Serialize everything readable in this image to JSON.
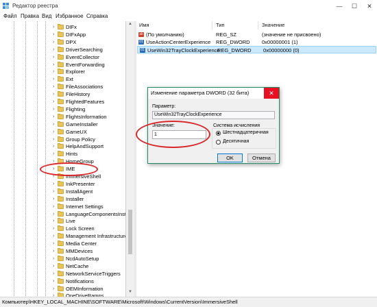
{
  "window": {
    "title": "Редактор реестра",
    "controls": [
      "—",
      "☐",
      "✕"
    ]
  },
  "menu": [
    "Файл",
    "Правка",
    "Вид",
    "Избранное",
    "Справка"
  ],
  "tree": {
    "items": [
      "DIFx",
      "DIFxApp",
      "DPX",
      "DriverSearching",
      "EventCollector",
      "EventForwarding",
      "Explorer",
      "Ext",
      "FileAssociations",
      "FileHistory",
      "FlightedFeatures",
      "Flighting",
      "FlightsInformation",
      "GameInstaller",
      "GameUX",
      "Group Policy",
      "HelpAndSupport",
      "Hints",
      "HomeGroup",
      "IME",
      "ImmersiveShell",
      "InkPresenter",
      "InstallAgent",
      "Installer",
      "Internet Settings",
      "LanguageComponentsInstall",
      "Live",
      "Lock Screen",
      "Management Infrastructure",
      "Media Center",
      "MMDevices",
      "NcdAutoSetup",
      "NetCache",
      "NetworkServiceTriggers",
      "Notifications",
      "OEMInformation",
      "OneDriveRamps"
    ],
    "selected": "ImmersiveShell"
  },
  "list": {
    "columns": [
      "Имя",
      "Тип",
      "Значение"
    ],
    "rows": [
      {
        "icon": "ab",
        "name": "(По умолчанию)",
        "type": "REG_SZ",
        "value": "(значение не присвоено)"
      },
      {
        "icon": "dword",
        "name": "UseActionCenterExperience",
        "type": "REG_DWORD",
        "value": "0x00000001 (1)"
      },
      {
        "icon": "dword",
        "name": "UseWin32TrayClockExperience",
        "type": "REG_DWORD",
        "value": "0x00000000 (0)"
      }
    ]
  },
  "dialog": {
    "title": "Изменение параметра DWORD (32 бита)",
    "param_label": "Параметр:",
    "param_value": "UseWin32TrayClockExperience",
    "value_label": "Значение:",
    "value_input": "1",
    "base_label": "Система исчисления",
    "hex_label": "Шестнадцатеричная",
    "dec_label": "Десятичная",
    "ok_label": "OK",
    "cancel_label": "Отмена",
    "close": "✕"
  },
  "status": "Компьютер\\HKEY_LOCAL_MACHINE\\SOFTWARE\\Microsoft\\Windows\\CurrentVersion\\ImmersiveShell",
  "colors": {
    "annotation": "#d8262b",
    "selection": "#cce8ff",
    "dialog_border": "#1e8c62",
    "close_red": "#e81123"
  }
}
